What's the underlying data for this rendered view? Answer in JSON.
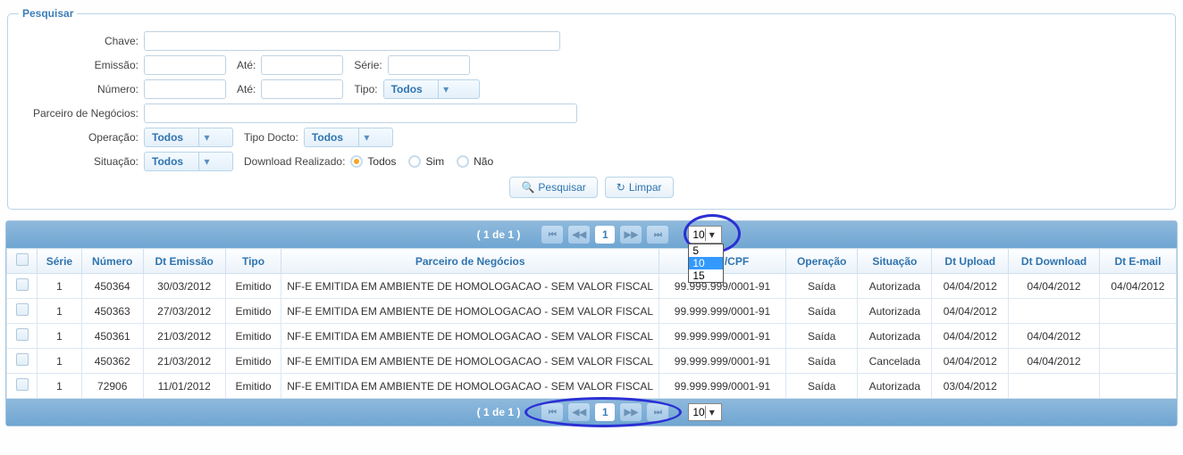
{
  "search": {
    "legend": "Pesquisar",
    "labels": {
      "chave": "Chave:",
      "emissao": "Emissão:",
      "ate": "Até:",
      "serie": "Série:",
      "numero": "Número:",
      "tipo": "Tipo:",
      "parceiro": "Parceiro de Negócios:",
      "operacao": "Operação:",
      "tipo_docto": "Tipo Docto:",
      "situacao": "Situação:",
      "download": "Download Realizado:"
    },
    "select": {
      "tipo": "Todos",
      "operacao": "Todos",
      "tipo_docto": "Todos",
      "situacao": "Todos"
    },
    "radio": {
      "todos": "Todos",
      "sim": "Sim",
      "nao": "Não",
      "selected": "todos"
    },
    "buttons": {
      "pesquisar": "Pesquisar",
      "limpar": "Limpar"
    }
  },
  "pager": {
    "text": "( 1 de 1 )",
    "current": "1",
    "rows_per_page": "10",
    "options": [
      "5",
      "10",
      "15"
    ]
  },
  "grid": {
    "columns": [
      "",
      "Série",
      "Número",
      "Dt Emissão",
      "Tipo",
      "Parceiro de Negócios",
      "CNPJ/CPF",
      "Operação",
      "Situação",
      "Dt Upload",
      "Dt Download",
      "Dt E-mail"
    ],
    "rows": [
      {
        "serie": "1",
        "numero": "450364",
        "dt_emissao": "30/03/2012",
        "tipo": "Emitido",
        "parceiro": "NF-E EMITIDA EM AMBIENTE DE HOMOLOGACAO - SEM VALOR FISCAL",
        "cnpj": "99.999.999/0001-91",
        "operacao": "Saída",
        "situacao": "Autorizada",
        "dt_upload": "04/04/2012",
        "dt_download": "04/04/2012",
        "dt_email": "04/04/2012"
      },
      {
        "serie": "1",
        "numero": "450363",
        "dt_emissao": "27/03/2012",
        "tipo": "Emitido",
        "parceiro": "NF-E EMITIDA EM AMBIENTE DE HOMOLOGACAO - SEM VALOR FISCAL",
        "cnpj": "99.999.999/0001-91",
        "operacao": "Saída",
        "situacao": "Autorizada",
        "dt_upload": "04/04/2012",
        "dt_download": "",
        "dt_email": ""
      },
      {
        "serie": "1",
        "numero": "450361",
        "dt_emissao": "21/03/2012",
        "tipo": "Emitido",
        "parceiro": "NF-E EMITIDA EM AMBIENTE DE HOMOLOGACAO - SEM VALOR FISCAL",
        "cnpj": "99.999.999/0001-91",
        "operacao": "Saída",
        "situacao": "Autorizada",
        "dt_upload": "04/04/2012",
        "dt_download": "04/04/2012",
        "dt_email": ""
      },
      {
        "serie": "1",
        "numero": "450362",
        "dt_emissao": "21/03/2012",
        "tipo": "Emitido",
        "parceiro": "NF-E EMITIDA EM AMBIENTE DE HOMOLOGACAO - SEM VALOR FISCAL",
        "cnpj": "99.999.999/0001-91",
        "operacao": "Saída",
        "situacao": "Cancelada",
        "dt_upload": "04/04/2012",
        "dt_download": "04/04/2012",
        "dt_email": ""
      },
      {
        "serie": "1",
        "numero": "72906",
        "dt_emissao": "11/01/2012",
        "tipo": "Emitido",
        "parceiro": "NF-E EMITIDA EM AMBIENTE DE HOMOLOGACAO - SEM VALOR FISCAL",
        "cnpj": "99.999.999/0001-91",
        "operacao": "Saída",
        "situacao": "Autorizada",
        "dt_upload": "03/04/2012",
        "dt_download": "",
        "dt_email": ""
      }
    ]
  }
}
